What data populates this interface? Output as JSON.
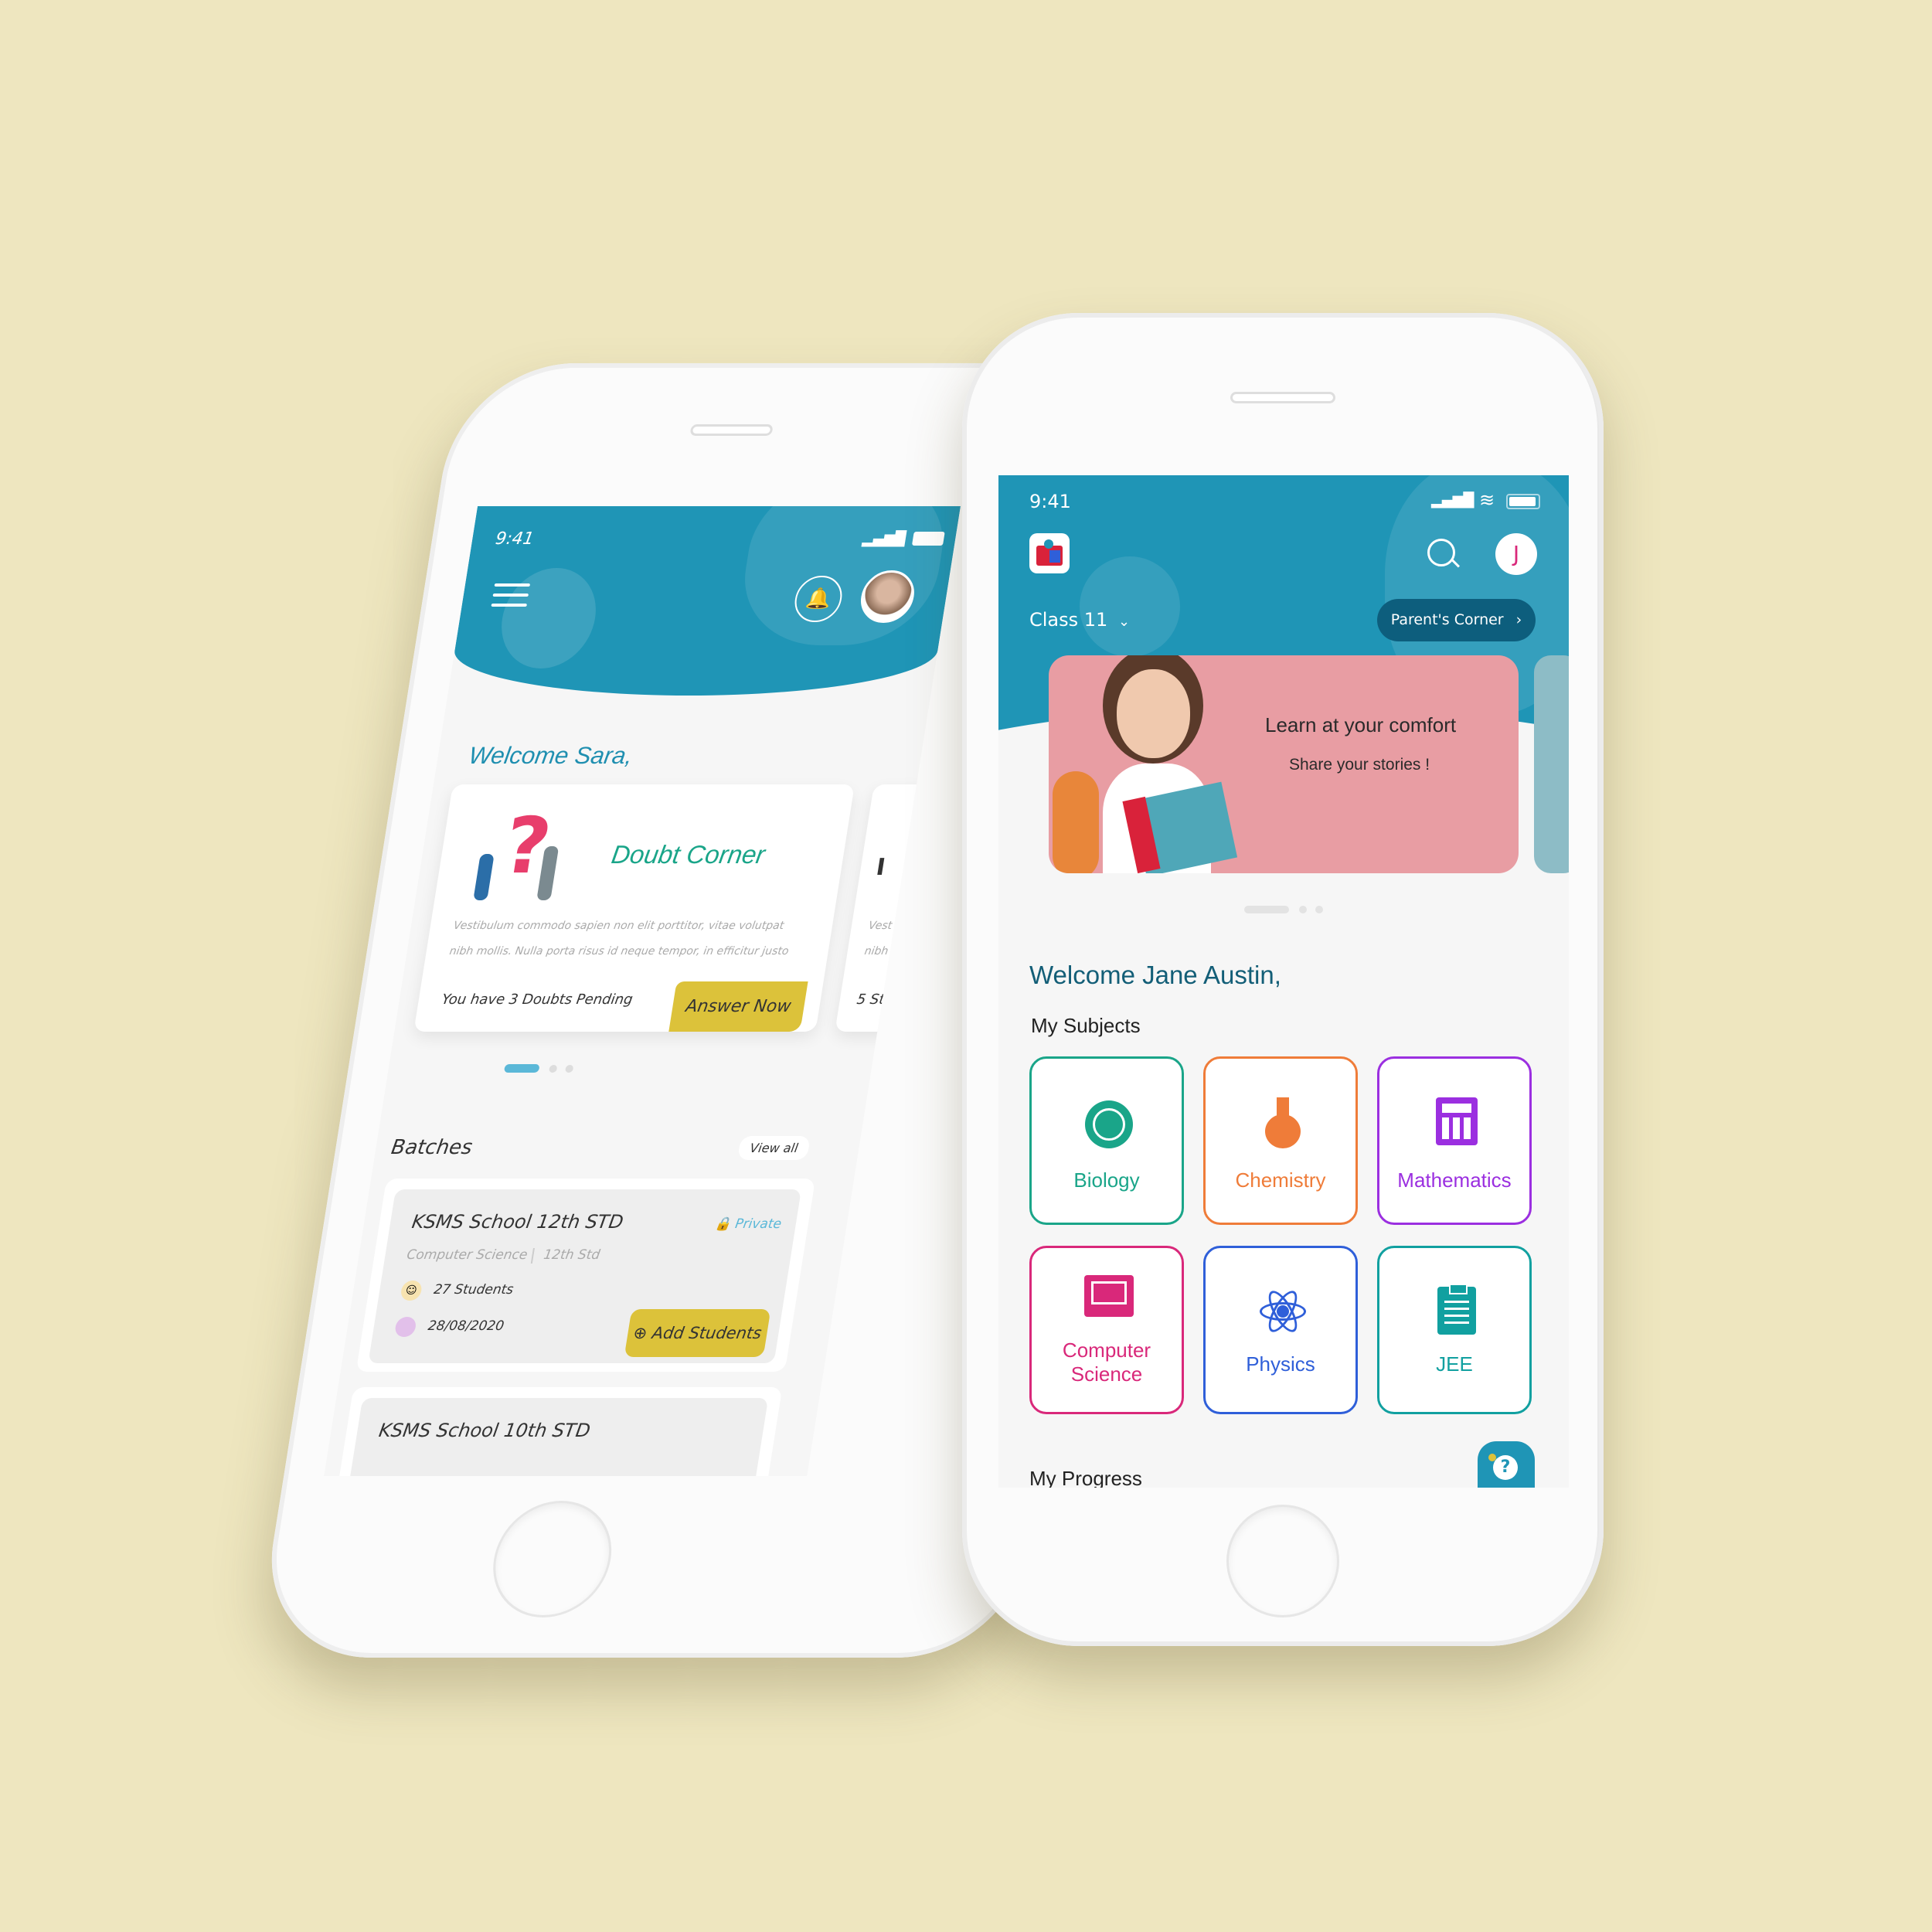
{
  "left_phone": {
    "status": {
      "time": "9:41"
    },
    "welcome": "Welcome Sara,",
    "doubt_card": {
      "title": "Doubt Corner",
      "body_line1": "Vestibulum commodo sapien non elit porttitor, vitae volutpat",
      "body_line2": "nibh mollis. Nulla porta risus id neque tempor, in efficitur justo",
      "pending": "You have 3 Doubts Pending",
      "cta": "Answer Now"
    },
    "next_card": {
      "title_fragment": "I",
      "body_line1": "Vest",
      "body_line2": "nibh",
      "pending": "5 St"
    },
    "batches": {
      "heading": "Batches",
      "view_all": "View all",
      "items": [
        {
          "name": "KSMS School 12th STD",
          "privacy": "Private",
          "subject": "Computer Science",
          "grade": "12th Std",
          "students": "27 Students",
          "date": "28/08/2020",
          "cta": "Add Students"
        },
        {
          "name": "KSMS School 10th STD"
        }
      ]
    }
  },
  "right_phone": {
    "status": {
      "time": "9:41"
    },
    "avatar_initial": "J",
    "class_selector": "Class 11",
    "parents_corner": "Parent's Corner",
    "banner": {
      "title": "Learn at your comfort",
      "subtitle": "Share your stories !"
    },
    "welcome": "Welcome Jane Austin,",
    "subjects_heading": "My Subjects",
    "subjects": [
      {
        "name": "Biology",
        "color": "#1AA589"
      },
      {
        "name": "Chemistry",
        "color": "#EF7C39"
      },
      {
        "name": "Mathematics",
        "color": "#9B2FE0"
      },
      {
        "name": "Computer Science",
        "line1": "Computer",
        "line2": "Science",
        "color": "#D9287A"
      },
      {
        "name": "Physics",
        "color": "#2F5FD9"
      },
      {
        "name": "JEE",
        "color": "#11A0A0"
      }
    ],
    "progress_heading": "My Progress"
  },
  "colors": {
    "background": "#EEE6BF",
    "header_teal": "#1F95B6",
    "accent_yellow": "#DCC23A",
    "banner_pink": "#E89DA3"
  }
}
